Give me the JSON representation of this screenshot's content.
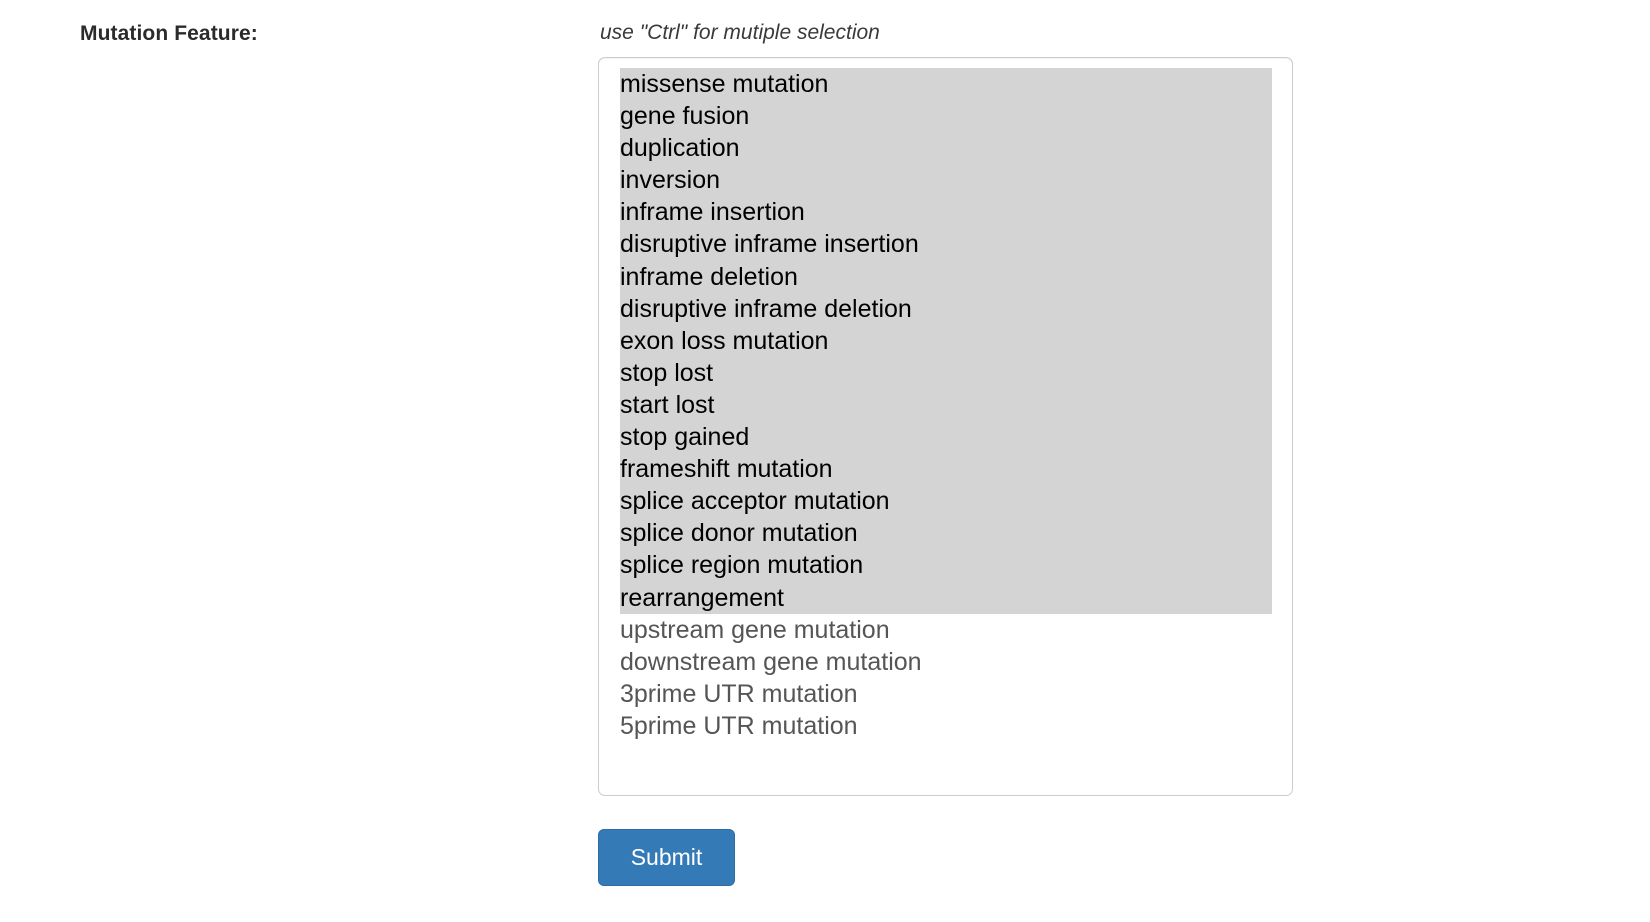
{
  "form": {
    "label": "Mutation Feature:",
    "hint": "use \"Ctrl\" for mutiple selection",
    "submit_label": "Submit",
    "accent_color": "#337ab7",
    "selection_color": "#d4d4d4",
    "options": [
      {
        "label": "missense mutation",
        "selected": true
      },
      {
        "label": "gene fusion",
        "selected": true
      },
      {
        "label": "duplication",
        "selected": true
      },
      {
        "label": "inversion",
        "selected": true
      },
      {
        "label": "inframe insertion",
        "selected": true
      },
      {
        "label": "disruptive inframe insertion",
        "selected": true
      },
      {
        "label": "inframe deletion",
        "selected": true
      },
      {
        "label": "disruptive inframe deletion",
        "selected": true
      },
      {
        "label": "exon loss mutation",
        "selected": true
      },
      {
        "label": "stop lost",
        "selected": true
      },
      {
        "label": "start lost",
        "selected": true
      },
      {
        "label": "stop gained",
        "selected": true
      },
      {
        "label": "frameshift mutation",
        "selected": true
      },
      {
        "label": "splice acceptor mutation",
        "selected": true
      },
      {
        "label": "splice donor mutation",
        "selected": true
      },
      {
        "label": "splice region mutation",
        "selected": true
      },
      {
        "label": "rearrangement",
        "selected": true
      },
      {
        "label": "upstream gene mutation",
        "selected": false
      },
      {
        "label": "downstream gene mutation",
        "selected": false
      },
      {
        "label": "3prime UTR mutation",
        "selected": false
      },
      {
        "label": "5prime UTR mutation",
        "selected": false
      }
    ]
  }
}
